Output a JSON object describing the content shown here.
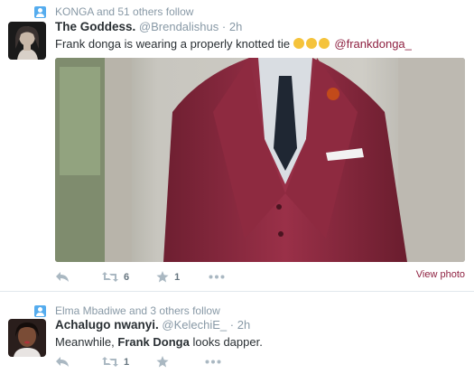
{
  "tweets": [
    {
      "context": "KONGA and 51 others follow",
      "fullname": "The Goddess.",
      "username": "@Brendalishus",
      "separator": "·",
      "time": "2h",
      "text": "Frank donga is wearing a properly knotted tie",
      "emoji_count": 3,
      "mention": "@frankdonga_",
      "retweets": "6",
      "favorites": "1",
      "view_photo": "View photo"
    },
    {
      "context": "Elma Mbadiwe and 3 others follow",
      "fullname": "Achalugo nwanyi.",
      "username": "@KelechiE_",
      "separator": "·",
      "time": "2h",
      "text_prefix": "Meanwhile,",
      "text_bold": "Frank Donga",
      "text_suffix": "looks dapper.",
      "retweets": "1"
    }
  ],
  "colors": {
    "link": "#8e2040",
    "secondary_text": "#8899a6",
    "context_icon": "#55acee",
    "suit": "#8b2a3e"
  }
}
